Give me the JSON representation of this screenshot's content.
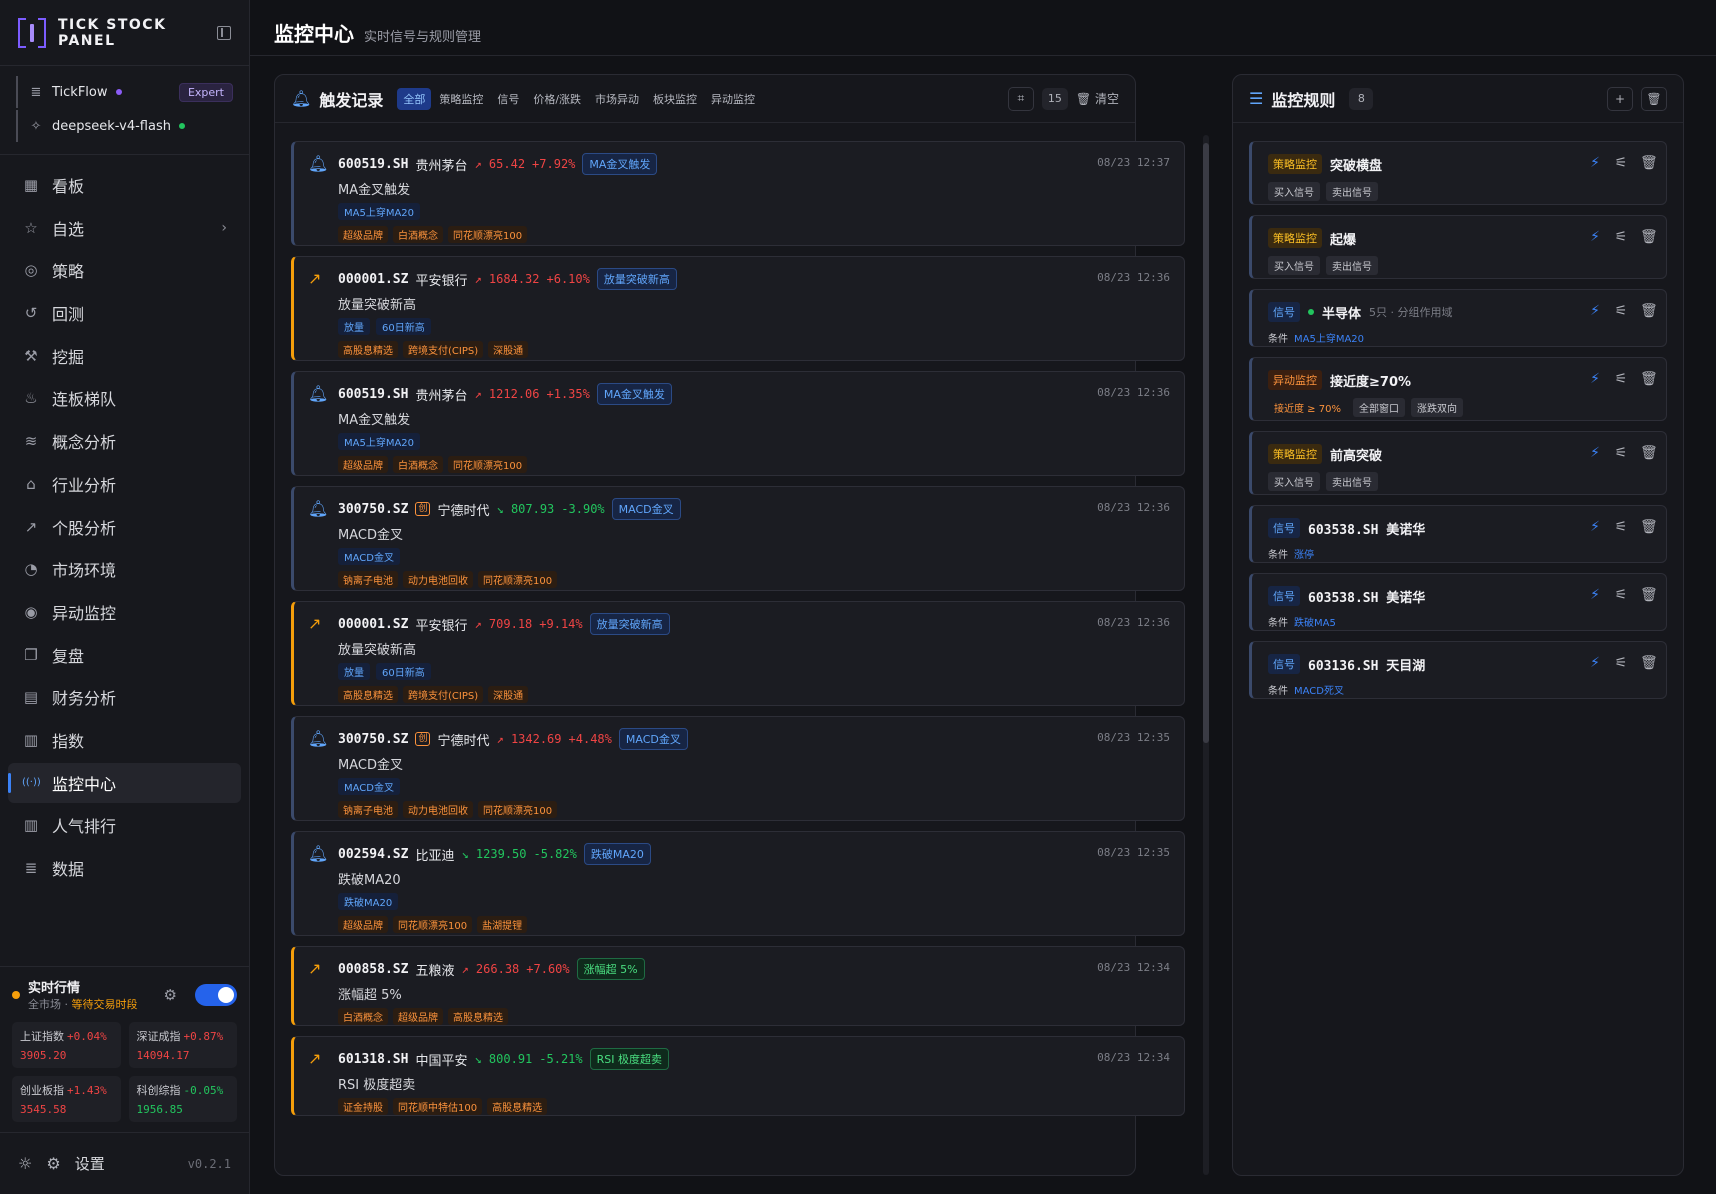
{
  "brand": {
    "title": "TICK STOCK PANEL"
  },
  "connections": [
    {
      "name": "TickFlow",
      "badge": "Expert"
    },
    {
      "name": "deepseek-v4-flash"
    }
  ],
  "nav": [
    {
      "label": "看板",
      "icon": "dashboard-icon"
    },
    {
      "label": "自选",
      "icon": "star-icon",
      "chevron": true
    },
    {
      "label": "策略",
      "icon": "strategy-icon"
    },
    {
      "label": "回测",
      "icon": "history-icon"
    },
    {
      "label": "挖掘",
      "icon": "pickaxe-icon"
    },
    {
      "label": "连板梯队",
      "icon": "flame-icon"
    },
    {
      "label": "概念分析",
      "icon": "layers-icon"
    },
    {
      "label": "行业分析",
      "icon": "bank-icon"
    },
    {
      "label": "个股分析",
      "icon": "trend-icon"
    },
    {
      "label": "市场环境",
      "icon": "gauge-icon"
    },
    {
      "label": "异动监控",
      "icon": "radar-icon"
    },
    {
      "label": "复盘",
      "icon": "book-icon"
    },
    {
      "label": "财务分析",
      "icon": "document-icon"
    },
    {
      "label": "指数",
      "icon": "bar-chart-icon"
    },
    {
      "label": "监控中心",
      "icon": "broadcast-icon",
      "active": true
    },
    {
      "label": "人气排行",
      "icon": "bar-chart-icon"
    },
    {
      "label": "数据",
      "icon": "database-icon"
    }
  ],
  "market": {
    "title": "实时行情",
    "scope": "全市场",
    "status": "等待交易时段",
    "indices": [
      {
        "name": "上证指数",
        "change": "+0.04%",
        "value": "3905.20",
        "dir": "up"
      },
      {
        "name": "深证成指",
        "change": "+0.87%",
        "value": "14094.17",
        "dir": "up"
      },
      {
        "name": "创业板指",
        "change": "+1.43%",
        "value": "3545.58",
        "dir": "up"
      },
      {
        "name": "科创综指",
        "change": "-0.05%",
        "value": "1956.85",
        "dir": "down"
      }
    ]
  },
  "footer": {
    "settings": "设置",
    "version": "v0.2.1"
  },
  "header": {
    "title": "监控中心",
    "subtitle": "实时信号与规则管理"
  },
  "events_panel": {
    "title": "触发记录",
    "filters": [
      "全部",
      "策略监控",
      "信号",
      "价格/涨跌",
      "市场异动",
      "板块监控",
      "异动监控"
    ],
    "count": "15",
    "clear": "清空"
  },
  "events": [
    {
      "kind": "bell",
      "code": "600519.SH",
      "name": "贵州茅台",
      "price": "65.42",
      "change": "+7.92%",
      "dir": "up",
      "tag": "MA金叉触发",
      "tag_style": "blue",
      "time": "08/23 12:37",
      "desc": "MA金叉触发",
      "conds": [
        "MA5上穿MA20"
      ],
      "chips": [
        "超级品牌",
        "白酒概念",
        "同花顺漂亮100"
      ]
    },
    {
      "kind": "trend",
      "code": "000001.SZ",
      "name": "平安银行",
      "price": "1684.32",
      "change": "+6.10%",
      "dir": "up",
      "tag": "放量突破新高",
      "tag_style": "blue",
      "time": "08/23 12:36",
      "desc": "放量突破新高",
      "conds": [
        "放量",
        "60日新高"
      ],
      "chips": [
        "高股息精选",
        "跨境支付(CIPS)",
        "深股通"
      ]
    },
    {
      "kind": "bell",
      "code": "600519.SH",
      "name": "贵州茅台",
      "price": "1212.06",
      "change": "+1.35%",
      "dir": "up",
      "tag": "MA金叉触发",
      "tag_style": "blue",
      "time": "08/23 12:36",
      "desc": "MA金叉触发",
      "conds": [
        "MA5上穿MA20"
      ],
      "chips": [
        "超级品牌",
        "白酒概念",
        "同花顺漂亮100"
      ]
    },
    {
      "kind": "bell",
      "code": "300750.SZ",
      "cn": "创",
      "name": "宁德时代",
      "price": "807.93",
      "change": "-3.90%",
      "dir": "down",
      "tag": "MACD金叉",
      "tag_style": "blue",
      "time": "08/23 12:36",
      "desc": "MACD金叉",
      "conds": [
        "MACD金叉"
      ],
      "chips": [
        "钠离子电池",
        "动力电池回收",
        "同花顺漂亮100"
      ]
    },
    {
      "kind": "trend",
      "code": "000001.SZ",
      "name": "平安银行",
      "price": "709.18",
      "change": "+9.14%",
      "dir": "up",
      "tag": "放量突破新高",
      "tag_style": "blue",
      "time": "08/23 12:36",
      "desc": "放量突破新高",
      "conds": [
        "放量",
        "60日新高"
      ],
      "chips": [
        "高股息精选",
        "跨境支付(CIPS)",
        "深股通"
      ]
    },
    {
      "kind": "bell",
      "code": "300750.SZ",
      "cn": "创",
      "name": "宁德时代",
      "price": "1342.69",
      "change": "+4.48%",
      "dir": "up",
      "tag": "MACD金叉",
      "tag_style": "blue",
      "time": "08/23 12:35",
      "desc": "MACD金叉",
      "conds": [
        "MACD金叉"
      ],
      "chips": [
        "钠离子电池",
        "动力电池回收",
        "同花顺漂亮100"
      ]
    },
    {
      "kind": "bell",
      "code": "002594.SZ",
      "name": "比亚迪",
      "price": "1239.50",
      "change": "-5.82%",
      "dir": "down",
      "tag": "跌破MA20",
      "tag_style": "blue",
      "time": "08/23 12:35",
      "desc": "跌破MA20",
      "conds": [
        "跌破MA20"
      ],
      "chips": [
        "超级品牌",
        "同花顺漂亮100",
        "盐湖提锂"
      ]
    },
    {
      "kind": "trend",
      "code": "000858.SZ",
      "name": "五粮液",
      "price": "266.38",
      "change": "+7.60%",
      "dir": "up",
      "tag": "涨幅超 5%",
      "tag_style": "green",
      "time": "08/23 12:34",
      "desc": "涨幅超 5%",
      "conds": [],
      "chips": [
        "白酒概念",
        "超级品牌",
        "高股息精选"
      ]
    },
    {
      "kind": "trend",
      "code": "601318.SH",
      "name": "中国平安",
      "price": "800.91",
      "change": "-5.21%",
      "dir": "down",
      "tag": "RSI 极度超卖",
      "tag_style": "green",
      "time": "08/23 12:34",
      "desc": "RSI 极度超卖",
      "conds": [],
      "chips": [
        "证金持股",
        "同花顺中特估100",
        "高股息精选"
      ]
    }
  ],
  "rules_panel": {
    "title": "监控规则",
    "count": "8"
  },
  "rules": [
    {
      "type": "策略监控",
      "type_style": "strategy",
      "name": "突破横盘",
      "chips": [
        "买入信号",
        "卖出信号"
      ]
    },
    {
      "type": "策略监控",
      "type_style": "strategy",
      "name": "起爆",
      "chips": [
        "买入信号",
        "卖出信号"
      ]
    },
    {
      "type": "信号",
      "type_style": "signal",
      "name": "半导体",
      "meta": "5只 · 分组作用域",
      "cond_label": "条件",
      "cond": "MA5上穿MA20"
    },
    {
      "type": "异动监控",
      "type_style": "abnormal",
      "name": "接近度≥70%",
      "chips_orange": [
        "接近度 ≥ 70%"
      ],
      "chips": [
        "全部窗口",
        "涨跌双向"
      ]
    },
    {
      "type": "策略监控",
      "type_style": "strategy",
      "name": "前高突破",
      "chips": [
        "买入信号",
        "卖出信号"
      ]
    },
    {
      "type": "信号",
      "type_style": "signal",
      "name": "603538.SH 美诺华",
      "cond_label": "条件",
      "cond": "涨停"
    },
    {
      "type": "信号",
      "type_style": "signal",
      "name": "603538.SH 美诺华",
      "cond_label": "条件",
      "cond": "跌破MA5"
    },
    {
      "type": "信号",
      "type_style": "signal",
      "name": "603136.SH 天目湖",
      "cond_label": "条件",
      "cond": "MACD死叉"
    }
  ]
}
